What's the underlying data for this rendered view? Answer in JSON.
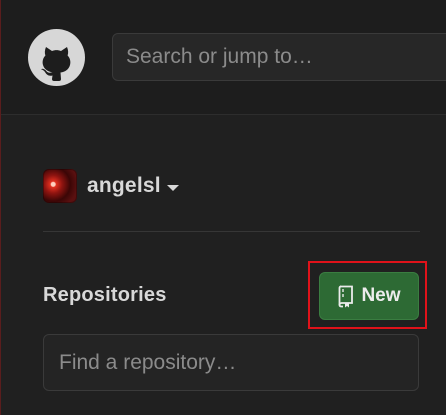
{
  "header": {
    "logo_icon": "github-mark-icon",
    "search_placeholder": "Search or jump to…"
  },
  "user": {
    "username": "angelsl",
    "avatar_icon": "avatar-image",
    "menu_icon": "caret-down-icon"
  },
  "repositories": {
    "title": "Repositories",
    "new_button_label": "New",
    "new_button_icon": "repo-book-icon",
    "new_button_color": "#2d6a34",
    "find_placeholder": "Find a repository…"
  },
  "highlight_color": "#e0121a"
}
